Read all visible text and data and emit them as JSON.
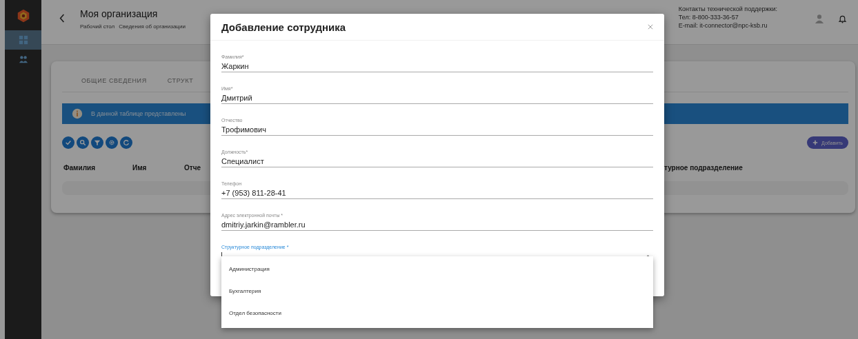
{
  "sidebar": {
    "items": [
      {
        "kind": "grid",
        "selected": true
      },
      {
        "kind": "people",
        "selected": false
      }
    ]
  },
  "header": {
    "title": "Моя организация",
    "breadcrumbs": [
      "Рабочий стол",
      "Сведения об организации"
    ],
    "support": {
      "title": "Контакты технической поддержки:",
      "phone": "Тел: 8-800-333-36-57",
      "email": "E-mail: it-connector@npc-ksb.ru"
    }
  },
  "tabs": [
    {
      "label": "ОБЩИЕ СВЕДЕНИЯ",
      "selected": false
    },
    {
      "label": "СТРУКТ",
      "selected": false
    }
  ],
  "info_banner": "В данной таблице представлены",
  "toolbar": [
    {
      "kind": "check"
    },
    {
      "kind": "search"
    },
    {
      "kind": "filter"
    },
    {
      "kind": "gear"
    },
    {
      "kind": "refresh"
    }
  ],
  "add_button": "Добавить",
  "table": {
    "columns": [
      "Фамилия",
      "Имя",
      "Отче",
      "турное подразделение"
    ]
  },
  "dialog": {
    "title": "Добавление сотрудника",
    "fields": [
      {
        "label": "Фамилия*",
        "value": "Жаркин",
        "focused": false
      },
      {
        "label": "Имя*",
        "value": "Дмитрий",
        "focused": false
      },
      {
        "label": "Отчество",
        "value": "Трофимович",
        "focused": false
      },
      {
        "label": "Должность*",
        "value": "Специалист",
        "focused": false
      },
      {
        "label": "Телефон",
        "value": "+7 (953) 811-28-41",
        "focused": false
      },
      {
        "label": "Адрес электронной почты *",
        "value": "dmitriy.jarkin@rambler.ru",
        "focused": false
      },
      {
        "label": "Структурное подразделение *",
        "focused": true
      }
    ],
    "dropdown": {
      "options": [
        "Администрация",
        "Бухгалтерия",
        "Отдел безопасности"
      ]
    }
  }
}
